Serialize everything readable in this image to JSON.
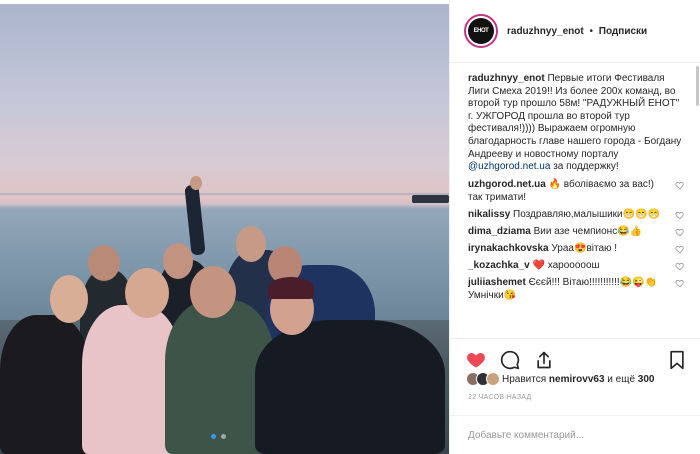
{
  "post": {
    "author": "raduzhnyy_enot",
    "separator": "•",
    "follow_label": "Подписки",
    "avatar_text": "ЕНОТ",
    "caption": {
      "user": "raduzhnyy_enot",
      "text": "Первые итоги Фестиваля Лиги Смеха 2019!! Из более 200х команд, во второй тур прошло 58м! \"РАДУЖНЫЙ ЕНОТ\" г. УЖГОРОД прошла во второй тур фестиваля!)))) Выражаем огромную благодарность главе нашего города - Богдану Андрееву и новостному порталу ",
      "link": "@uzhgorod.net.ua",
      "tail": " за поддержку!"
    },
    "comments": [
      {
        "user": "uzhgorod.net.ua",
        "text": "🔥 вболіваємо за вас!) так тримати!"
      },
      {
        "user": "nikalissy",
        "text": "Поздравляю,малышики😁😁😁"
      },
      {
        "user": "dima_dziama",
        "text": "Вии азе чемпионс😂👍"
      },
      {
        "user": "irynakachkovska",
        "text": "Ураа😍вітаю !"
      },
      {
        "user": "_kozachka_v",
        "text": "❤️ харооооош"
      },
      {
        "user": "juliiashemet",
        "text": "Єєєй!!! Вітаю!!!!!!!!!!!😂😜👏 Умнічки😘"
      }
    ],
    "likes": {
      "prefix": "Нравится",
      "user": "nemirovv63",
      "suffix": "и ещё",
      "count": "300"
    },
    "timestamp": "22 ЧАСОВ НАЗАД",
    "add_comment_placeholder": "Добавьте комментарий...",
    "carousel": {
      "total": 2,
      "active": 0
    }
  },
  "colors": {
    "heart_liked": "#ed4956",
    "link": "#003569",
    "carousel_active": "#3897f0",
    "avatar_ring": "#c13584"
  },
  "icons": [
    "heart-icon",
    "comment-icon",
    "share-icon",
    "bookmark-icon",
    "comment-like-heart-icon"
  ]
}
